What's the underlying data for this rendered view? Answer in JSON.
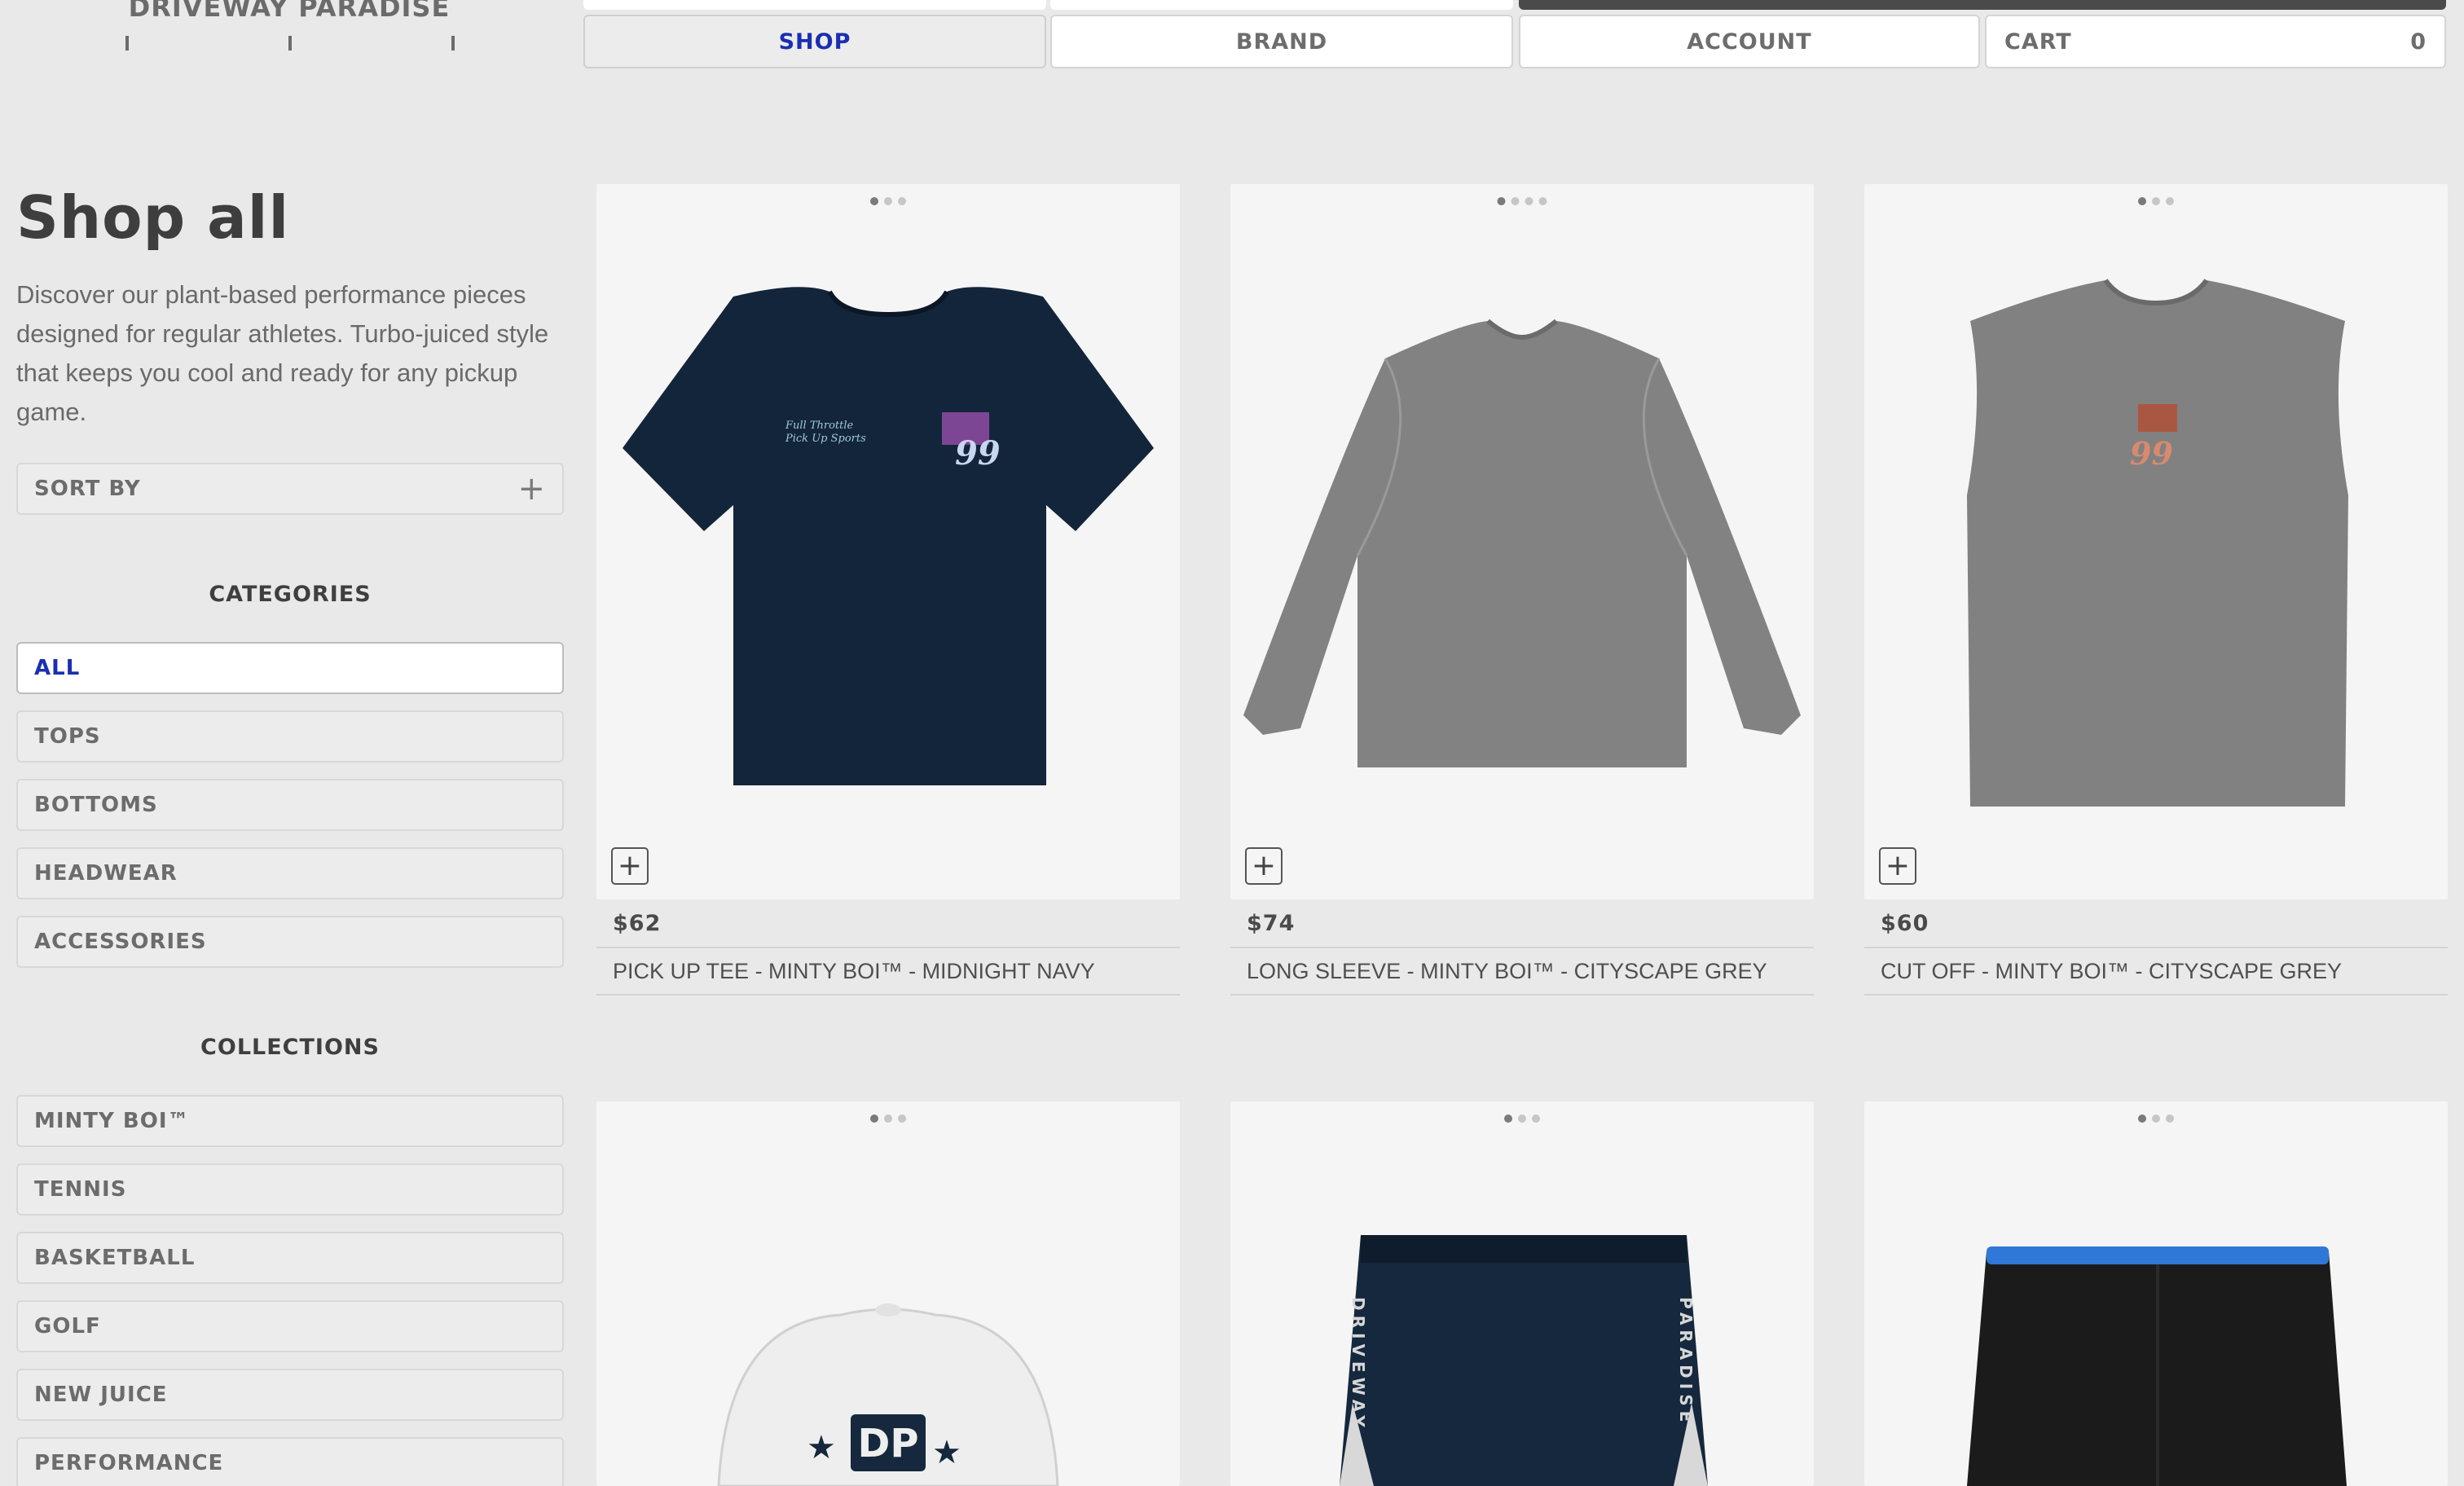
{
  "brand": {
    "name": "DRIVEWAY PARADISE"
  },
  "nav": {
    "items": [
      {
        "label": "SHOP",
        "active": true
      },
      {
        "label": "BRAND",
        "active": false
      },
      {
        "label": "ACCOUNT",
        "active": false
      },
      {
        "label": "CART",
        "active": false
      }
    ],
    "cart_count": "0"
  },
  "page": {
    "title": "Shop all",
    "description": "Discover our plant-based performance pieces designed for regular athletes. Turbo-juiced style that keeps you cool and ready for any pickup game."
  },
  "sort": {
    "label": "SORT BY",
    "icon": "plus-icon"
  },
  "categories": {
    "heading": "CATEGORIES",
    "items": [
      {
        "label": "ALL",
        "selected": true
      },
      {
        "label": "TOPS",
        "selected": false
      },
      {
        "label": "BOTTOMS",
        "selected": false
      },
      {
        "label": "HEADWEAR",
        "selected": false
      },
      {
        "label": "ACCESSORIES",
        "selected": false
      }
    ]
  },
  "collections": {
    "heading": "COLLECTIONS",
    "items": [
      {
        "label": "MINTY BOI™"
      },
      {
        "label": "TENNIS"
      },
      {
        "label": "BASKETBALL"
      },
      {
        "label": "GOLF"
      },
      {
        "label": "NEW JUICE"
      },
      {
        "label": "PERFORMANCE"
      }
    ]
  },
  "products": [
    {
      "price": "$62",
      "name": "PICK UP TEE - MINTY BOI™ - MIDNIGHT NAVY",
      "image_dots": 3,
      "active_dot": 1,
      "color": "#13253a"
    },
    {
      "price": "$74",
      "name": "LONG SLEEVE - MINTY BOI™ - CITYSCAPE GREY",
      "image_dots": 4,
      "active_dot": 1,
      "color": "#828282"
    },
    {
      "price": "$60",
      "name": "CUT OFF - MINTY BOI™ - CITYSCAPE GREY",
      "image_dots": 3,
      "active_dot": 1,
      "color": "#818181"
    },
    {
      "image_dots": 3,
      "active_dot": 1,
      "color": "#eeeeee",
      "logo_text": "DP"
    },
    {
      "image_dots": 3,
      "active_dot": 1,
      "color": "#15283d",
      "side_text_left": "DRIVEWAY",
      "side_text_right": "PARADISE"
    },
    {
      "image_dots": 3,
      "active_dot": 1,
      "color": "#1b1b1b",
      "accent": "#2f78d8"
    }
  ],
  "colors": {
    "accent_blue": "#1a2fb0"
  }
}
